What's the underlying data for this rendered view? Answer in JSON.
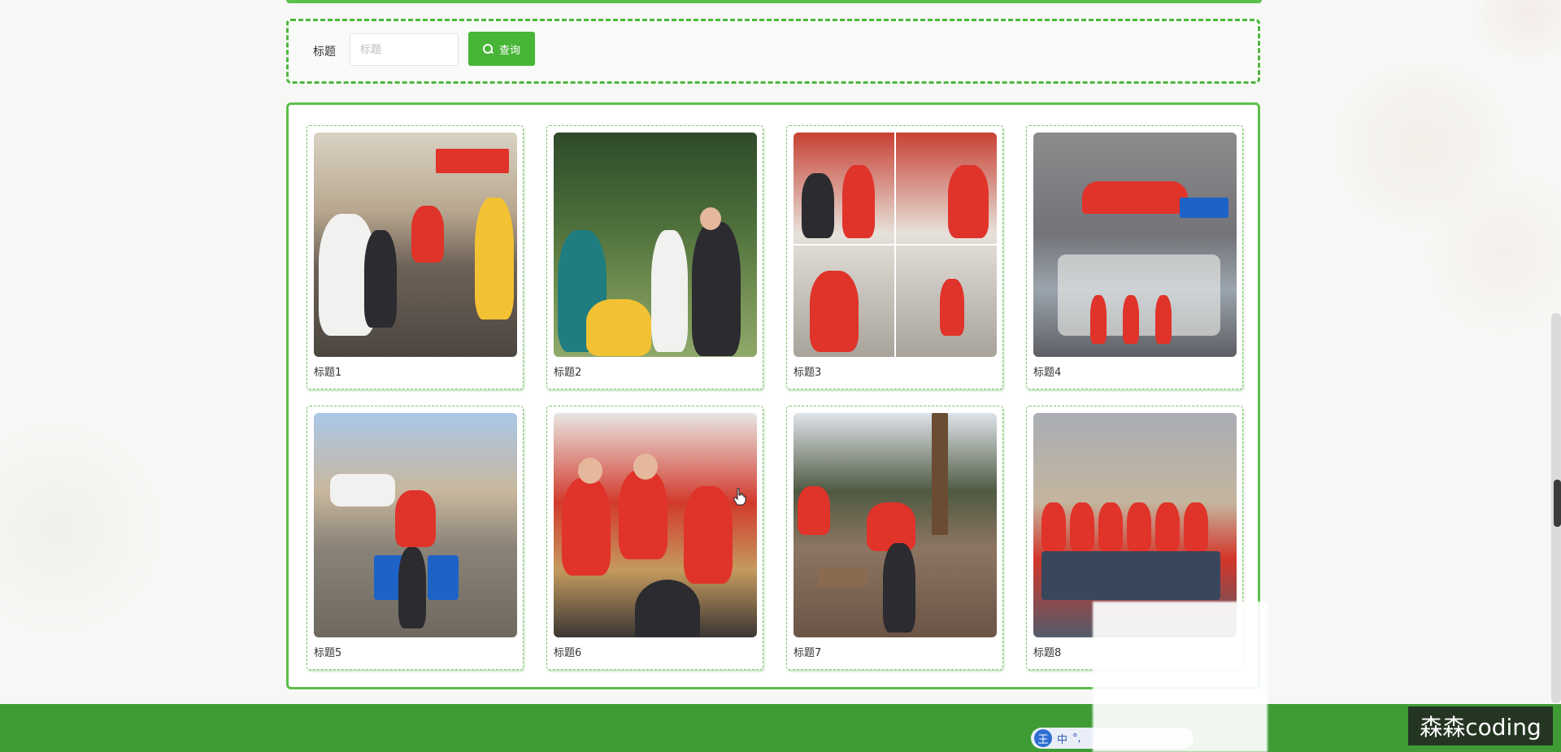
{
  "search": {
    "label": "标题",
    "placeholder": "标题",
    "value": "",
    "button_label": "查询"
  },
  "gallery": {
    "items": [
      {
        "title": "标题1"
      },
      {
        "title": "标题2"
      },
      {
        "title": "标题3"
      },
      {
        "title": "标题4"
      },
      {
        "title": "标题5"
      },
      {
        "title": "标题6"
      },
      {
        "title": "标题7"
      },
      {
        "title": "标题8"
      }
    ]
  },
  "ime": {
    "logo": "王",
    "mode": "中",
    "punct": "°,"
  },
  "watermark": "森森coding",
  "colors": {
    "accent": "#47b536",
    "border": "#5cbf4a",
    "footer": "#3f9c35"
  },
  "icons": {
    "search_button": "search-icon",
    "pointer": "hand-pointer-icon"
  }
}
